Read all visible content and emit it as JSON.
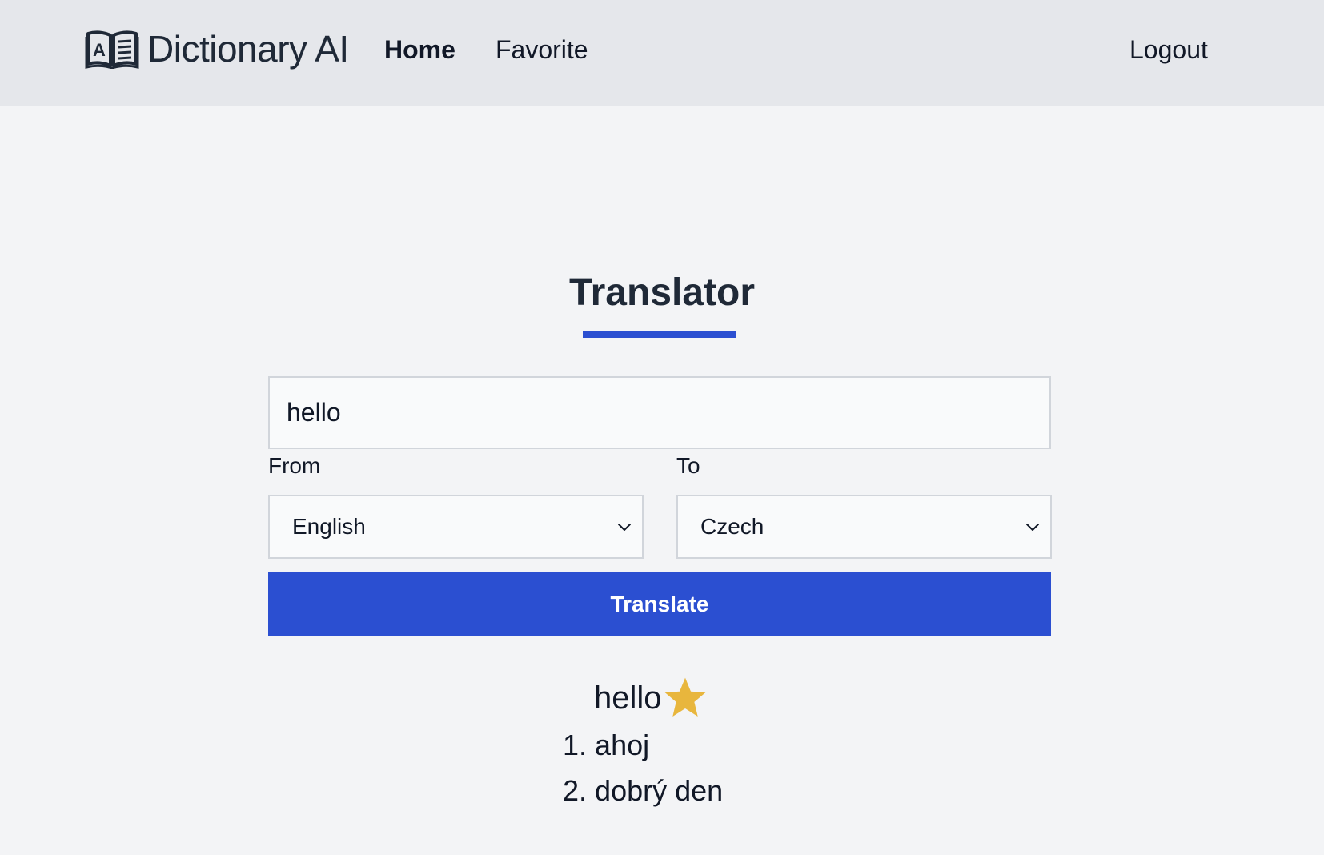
{
  "header": {
    "brand": "Dictionary AI",
    "nav": {
      "home": "Home",
      "favorite": "Favorite",
      "logout": "Logout"
    }
  },
  "translator": {
    "title": "Translator",
    "input_value": "hello",
    "from_label": "From",
    "from_value": "English",
    "to_label": "To",
    "to_value": "Czech",
    "button_label": "Translate"
  },
  "result": {
    "word": "hello",
    "favorite_icon": "star-icon",
    "translations": [
      {
        "num": "1.",
        "text": "ahoj"
      },
      {
        "num": "2.",
        "text": "dobrý den"
      }
    ]
  },
  "colors": {
    "accent": "#2b4fd1",
    "star": "#e8b63d",
    "navbar_bg": "#e5e7eb",
    "page_bg": "#f3f4f6"
  }
}
